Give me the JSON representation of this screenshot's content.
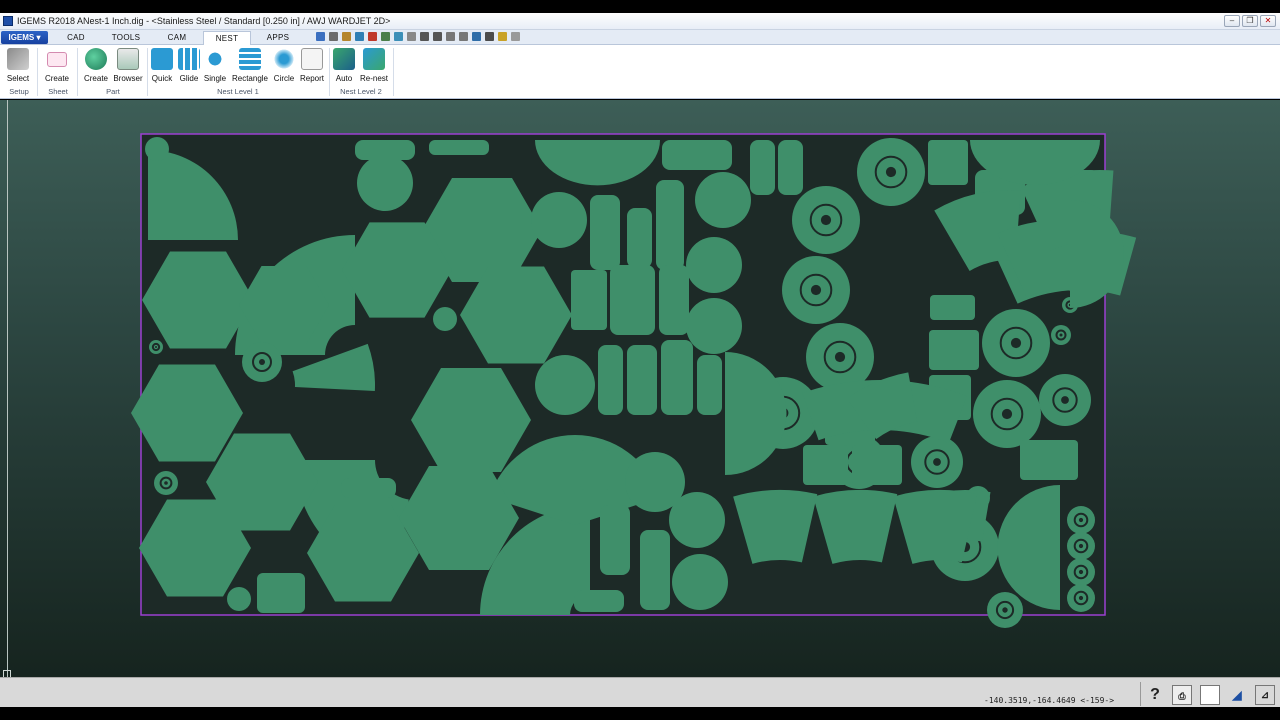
{
  "window": {
    "title": "IGEMS R2018  ANest-1 Inch.dig - <Stainless Steel / Standard [0.250 in] / AWJ WARDJET 2D>",
    "buttons": [
      "–",
      "❐",
      "✕"
    ]
  },
  "menu": {
    "app_button": "IGEMS ▾",
    "tabs": [
      {
        "label": "CAD"
      },
      {
        "label": "TOOLS"
      },
      {
        "label": "CAM"
      },
      {
        "label": "NEST"
      },
      {
        "label": "APPS"
      }
    ],
    "active_tab": "NEST"
  },
  "ribbon": {
    "buttons": {
      "select": "Select",
      "create_sheet": "Create",
      "create_part": "Create",
      "browser": "Browser",
      "quick": "Quick",
      "glide": "Glide",
      "single": "Single",
      "rectangle": "Rectangle",
      "circle": "Circle",
      "report": "Report",
      "auto": "Auto",
      "renest": "Re-nest"
    },
    "groups": {
      "setup": "Setup",
      "sheet": "Sheet",
      "part": "Part",
      "nest1": "Nest Level 1",
      "nest2": "Nest Level 2"
    }
  },
  "colors": {
    "part_fill": "#3f8f6a",
    "sheet_bg": "#1d2a27",
    "sheet_border": "#9b3fd1"
  },
  "status": {
    "coordinates": "-140.3519,-164.4649 <-159->",
    "help_icon": "?"
  }
}
